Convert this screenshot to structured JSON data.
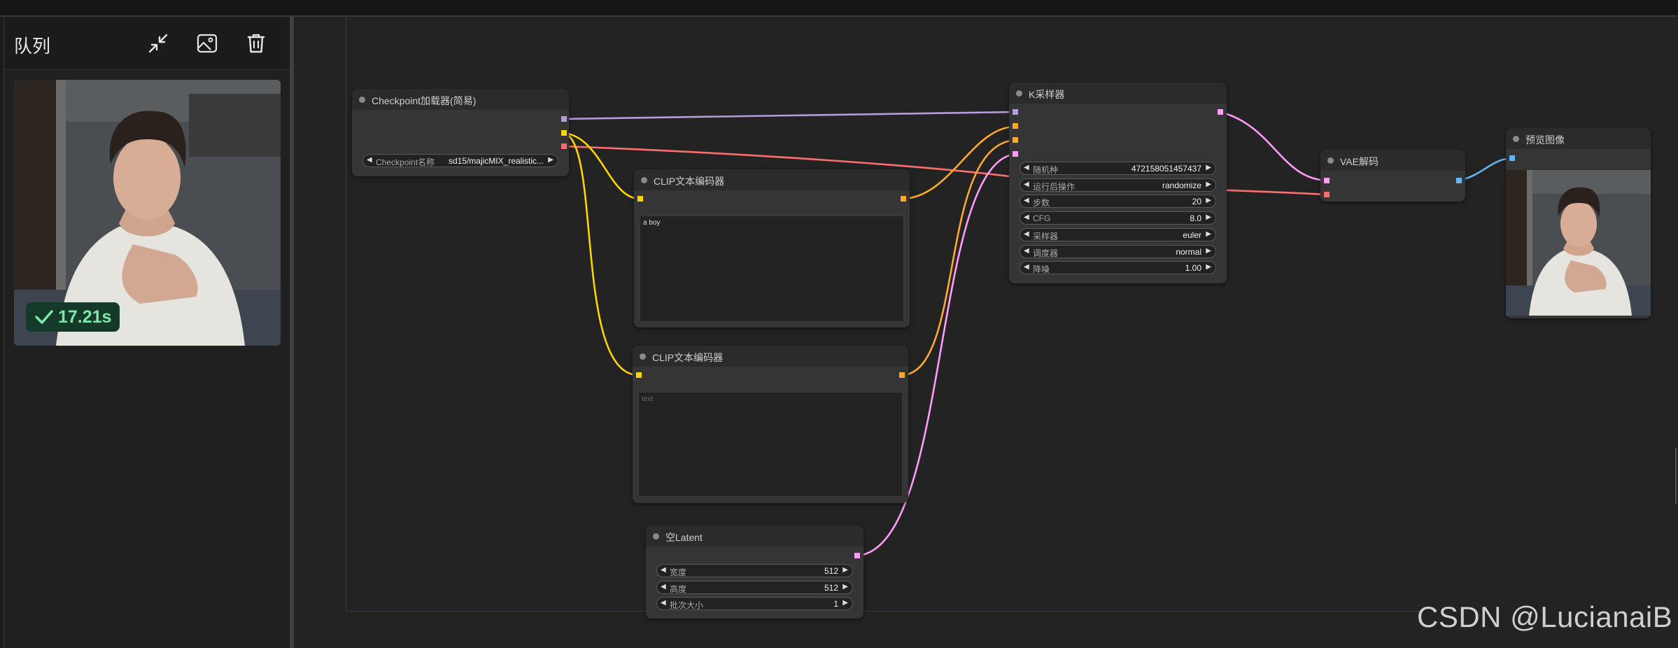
{
  "sidebar": {
    "title": "队列",
    "buttons": [
      {
        "icon": "collapse-arrows-icon"
      },
      {
        "icon": "image-icon"
      },
      {
        "icon": "trash-icon"
      }
    ],
    "queue_items": [
      {
        "status_icon": "checkmark-icon",
        "duration": "17.21s"
      }
    ]
  },
  "nodes": {
    "checkpoint": {
      "title": "Checkpoint加载器(简易)",
      "widgets": [
        {
          "label": "Checkpoint名称",
          "value": "sd15/majicMIX_realistic..."
        }
      ]
    },
    "clip_positive": {
      "title": "CLIP文本编码器",
      "text": "a boy"
    },
    "clip_negative": {
      "title": "CLIP文本编码器",
      "placeholder": "text"
    },
    "empty_latent": {
      "title": "空Latent",
      "widgets": [
        {
          "label": "宽度",
          "value": "512"
        },
        {
          "label": "高度",
          "value": "512"
        },
        {
          "label": "批次大小",
          "value": "1"
        }
      ]
    },
    "ksampler": {
      "title": "K采样器",
      "widgets": [
        {
          "label": "随机种",
          "value": "472158051457437"
        },
        {
          "label": "运行后操作",
          "value": "randomize"
        },
        {
          "label": "步数",
          "value": "20"
        },
        {
          "label": "CFG",
          "value": "8.0"
        },
        {
          "label": "采样器",
          "value": "euler"
        },
        {
          "label": "调度器",
          "value": "normal"
        },
        {
          "label": "降噪",
          "value": "1.00"
        }
      ]
    },
    "vae_decode": {
      "title": "VAE解码"
    },
    "preview": {
      "title": "预览图像"
    }
  },
  "colors": {
    "model": "#b39ddb",
    "clip": "#ffd500",
    "vae": "#ff6e6e",
    "conditioning": "#ffa931",
    "latent": "#ff9cf9",
    "image": "#64b5f6"
  },
  "watermark": "CSDN @LucianaiB"
}
